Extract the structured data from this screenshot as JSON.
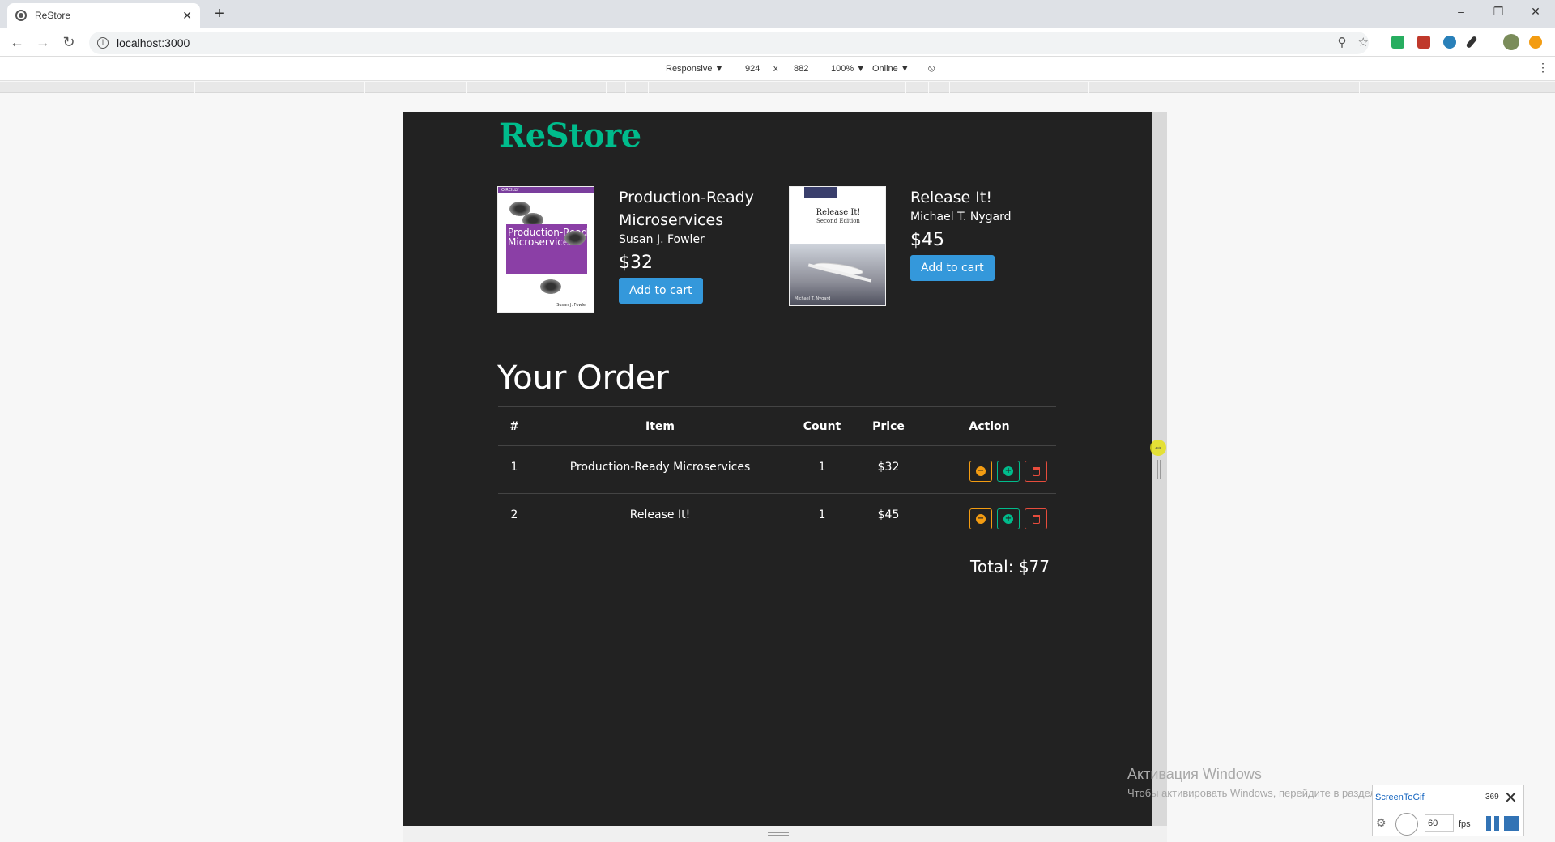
{
  "browser": {
    "tab_title": "ReStore",
    "tab_close": "✕",
    "new_tab": "+",
    "url": "localhost:3000",
    "window_controls": [
      "–",
      "❐",
      "✕"
    ]
  },
  "devtools": {
    "device": "Responsive ▼",
    "width": "924",
    "times": "x",
    "height": "882",
    "zoom": "100% ▼",
    "network": "Online ▼"
  },
  "app": {
    "brand": "ReStore",
    "books": [
      {
        "title": "Production-Ready Microservices",
        "author": "Susan J. Fowler",
        "price": "$32",
        "button": "Add to cart",
        "cover_text": "Production-Ready Microservices",
        "cover_publisher": "O'REILLY",
        "cover_author": "Susan J. Fowler"
      },
      {
        "title": "Release It!",
        "author": "Michael T. Nygard",
        "price": "$45",
        "button": "Add to cart",
        "cover_text": "Release It!",
        "cover_sub": "Second Edition",
        "cover_author": "Michael T. Nygard"
      }
    ],
    "order": {
      "heading": "Your Order",
      "columns": [
        "#",
        "Item",
        "Count",
        "Price",
        "Action"
      ],
      "rows": [
        {
          "num": "1",
          "item": "Production-Ready Microservices",
          "count": "1",
          "price": "$32"
        },
        {
          "num": "2",
          "item": "Release It!",
          "count": "1",
          "price": "$45"
        }
      ],
      "total": "Total: $77"
    }
  },
  "os": {
    "activate_title": "Активация Windows",
    "activate_text": "Чтобы активировать Windows, перейдите в раздел \"Параметры\"."
  },
  "screentogif": {
    "name": "ScreenToGif",
    "counter": "369",
    "fps_value": "60",
    "fps_label": "fps"
  },
  "colors": {
    "brand": "#00bc8c",
    "primary": "#3498db",
    "warning": "#f39c12",
    "success": "#00bc8c",
    "danger": "#e74c3c",
    "background": "#222222"
  }
}
